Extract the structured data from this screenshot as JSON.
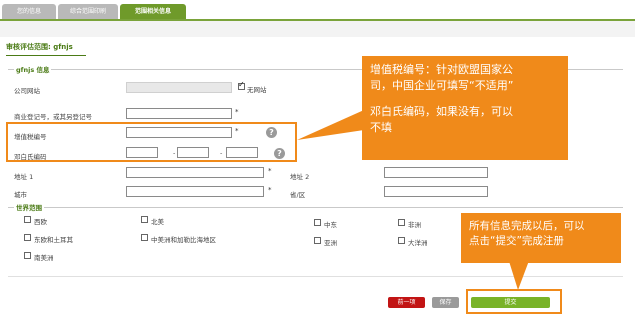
{
  "tabs": [
    {
      "label": "您的信息"
    },
    {
      "label": "综合范围印刷"
    },
    {
      "label": "范围相关信息"
    }
  ],
  "page_heading": "审核评估范围: gfnjs",
  "company_section": {
    "title": "gfnjs 信息",
    "website_label": "公司网站",
    "no_website_label": "无网站",
    "business_reg_label": "商业登记号，或其另登记号",
    "vat_label": "增值税编号",
    "duns_label": "邓白氏编码",
    "dash1": "-",
    "dash2": "-",
    "address1_label": "地址 1",
    "address2_label": "地址 2",
    "city_label": "城市",
    "province_label": "省/区",
    "star": "*"
  },
  "world_scope": {
    "title": "世界范围",
    "regions": [
      {
        "label": "西欧"
      },
      {
        "label": "北美"
      },
      {
        "label": "中东"
      },
      {
        "label": "非洲"
      },
      {
        "label": "东欧和土耳其"
      },
      {
        "label": "中美洲和加勒比海地区"
      },
      {
        "label": "亚洲"
      },
      {
        "label": "大洋洲"
      },
      {
        "label": "南美洲"
      }
    ]
  },
  "buttons": {
    "prev": "前一项",
    "save": "保存",
    "submit": "提交"
  },
  "callouts": {
    "top_line1": "增值税编号：针对欧盟国家公",
    "top_line2": "司，中国企业可填写“不适用”",
    "top_line3": "邓白氏编码，如果没有，可以",
    "top_line4": "不填",
    "bottom_line1": "所有信息完成以后，可以",
    "bottom_line2": "点击“提交”完成注册"
  },
  "colors": {
    "accent_green": "#6f9a2a",
    "callout_orange": "#f08a1a",
    "prev_red": "#c21414"
  }
}
